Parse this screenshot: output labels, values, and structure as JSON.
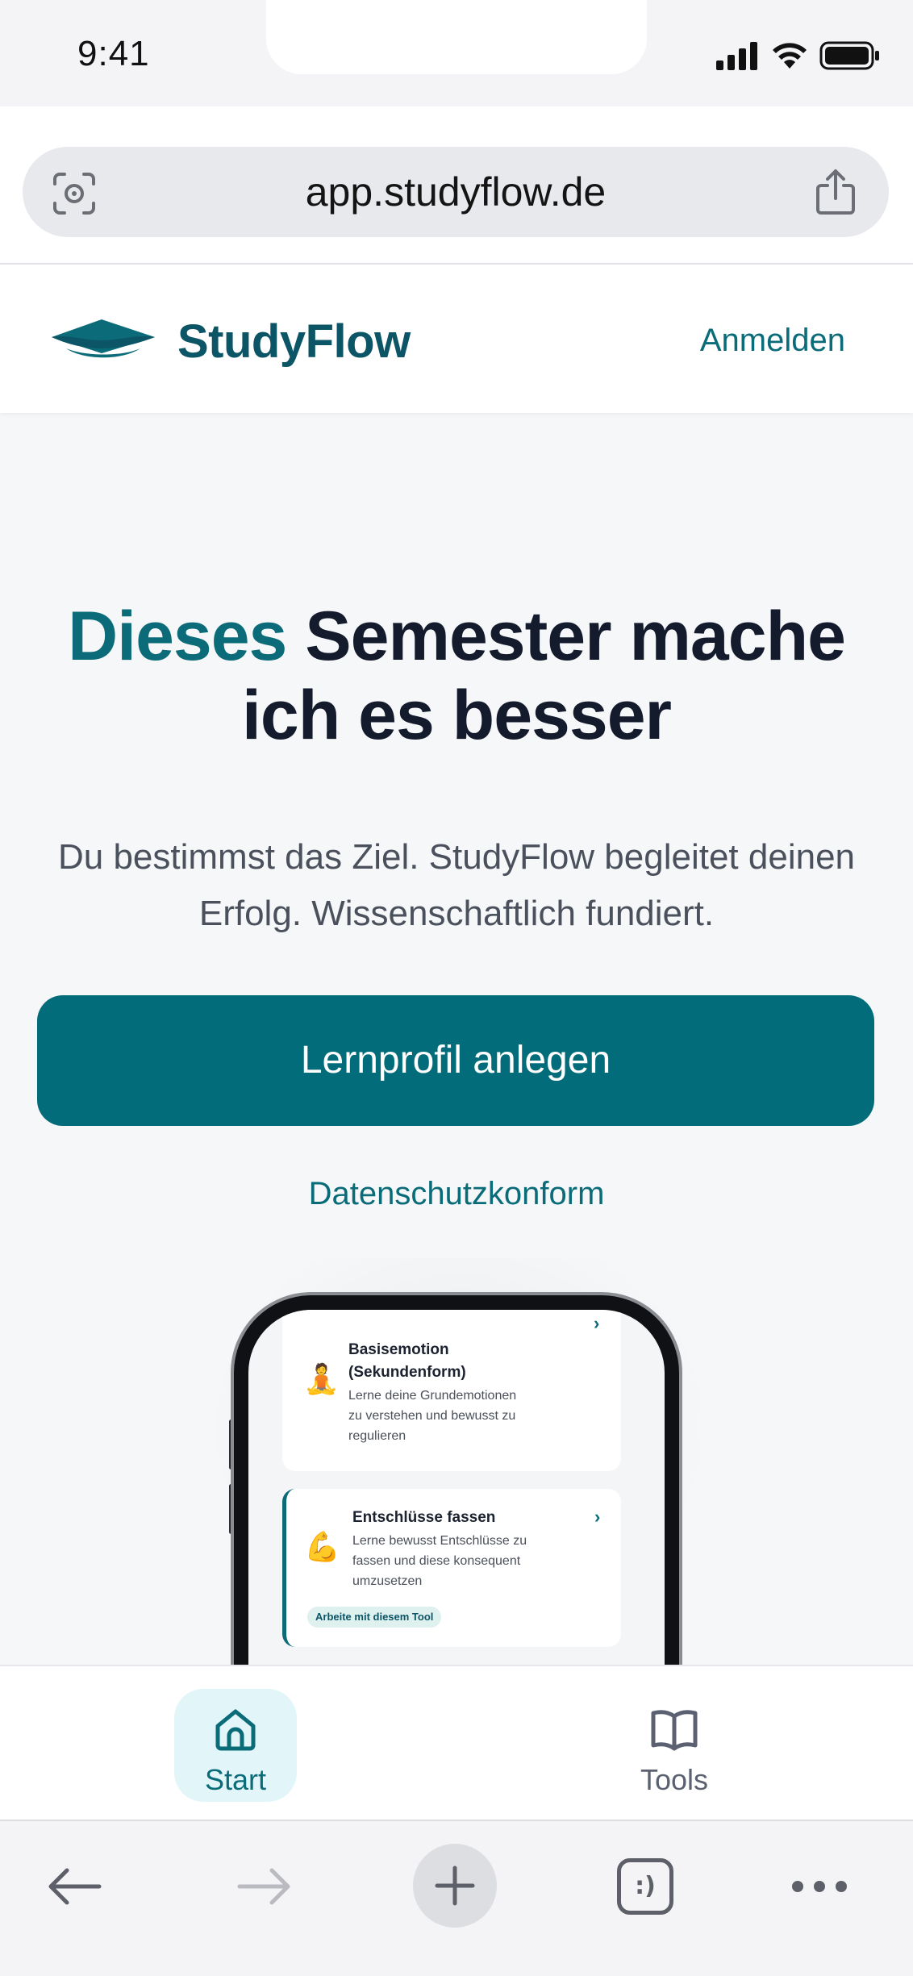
{
  "status_bar": {
    "time": "9:41",
    "icons": [
      "signal-icon",
      "wifi-icon",
      "battery-icon"
    ]
  },
  "browser": {
    "url": "app.studyflow.de",
    "left_icon": "visual-search-icon",
    "right_icon": "share-icon"
  },
  "site_header": {
    "brand": "StudyFlow",
    "logo_icon": "graduation-cap-icon",
    "login_label": "Anmelden"
  },
  "hero": {
    "title_accent": "Dieses",
    "title_rest": "Semester mache ich es besser",
    "subtitle": "Du bestimmst das Ziel. StudyFlow begleitet deinen Erfolg. Wissenschaftlich fundiert.",
    "cta_label": "Lernprofil anlegen",
    "privacy_label": "Datenschutzkonform"
  },
  "phone_preview": {
    "cards": [
      {
        "emoji": "🧘",
        "title_line1": "Basisemotion",
        "title_line2": "(Sekundenform)",
        "desc_line1": "Lerne deine Grundemotionen",
        "desc_line2": "zu verstehen und bewusst zu",
        "desc_line3": "regulieren"
      },
      {
        "emoji": "💪",
        "title_line1": "Entschlüsse fassen",
        "desc_line1": "Lerne bewusst Entschlüsse zu",
        "desc_line2": "fassen und diese konsequent",
        "desc_line3": "umzusetzen",
        "badge": "Arbeite mit diesem Tool"
      }
    ]
  },
  "app_nav": {
    "items": [
      {
        "label": "Start",
        "icon": "home-icon",
        "active": true
      },
      {
        "label": "Tools",
        "icon": "book-icon",
        "active": false
      }
    ]
  },
  "browser_toolbar": {
    "icons": [
      "back-arrow-icon",
      "forward-arrow-icon",
      "new-tab-plus-icon",
      "tabs-icon",
      "more-icon"
    ],
    "tabs_glyph": ":)"
  },
  "colors": {
    "accent": "#036c7a",
    "brand_dark": "#0b5566",
    "heading": "#141b2d",
    "nav_active_bg": "#e2f6f9"
  }
}
